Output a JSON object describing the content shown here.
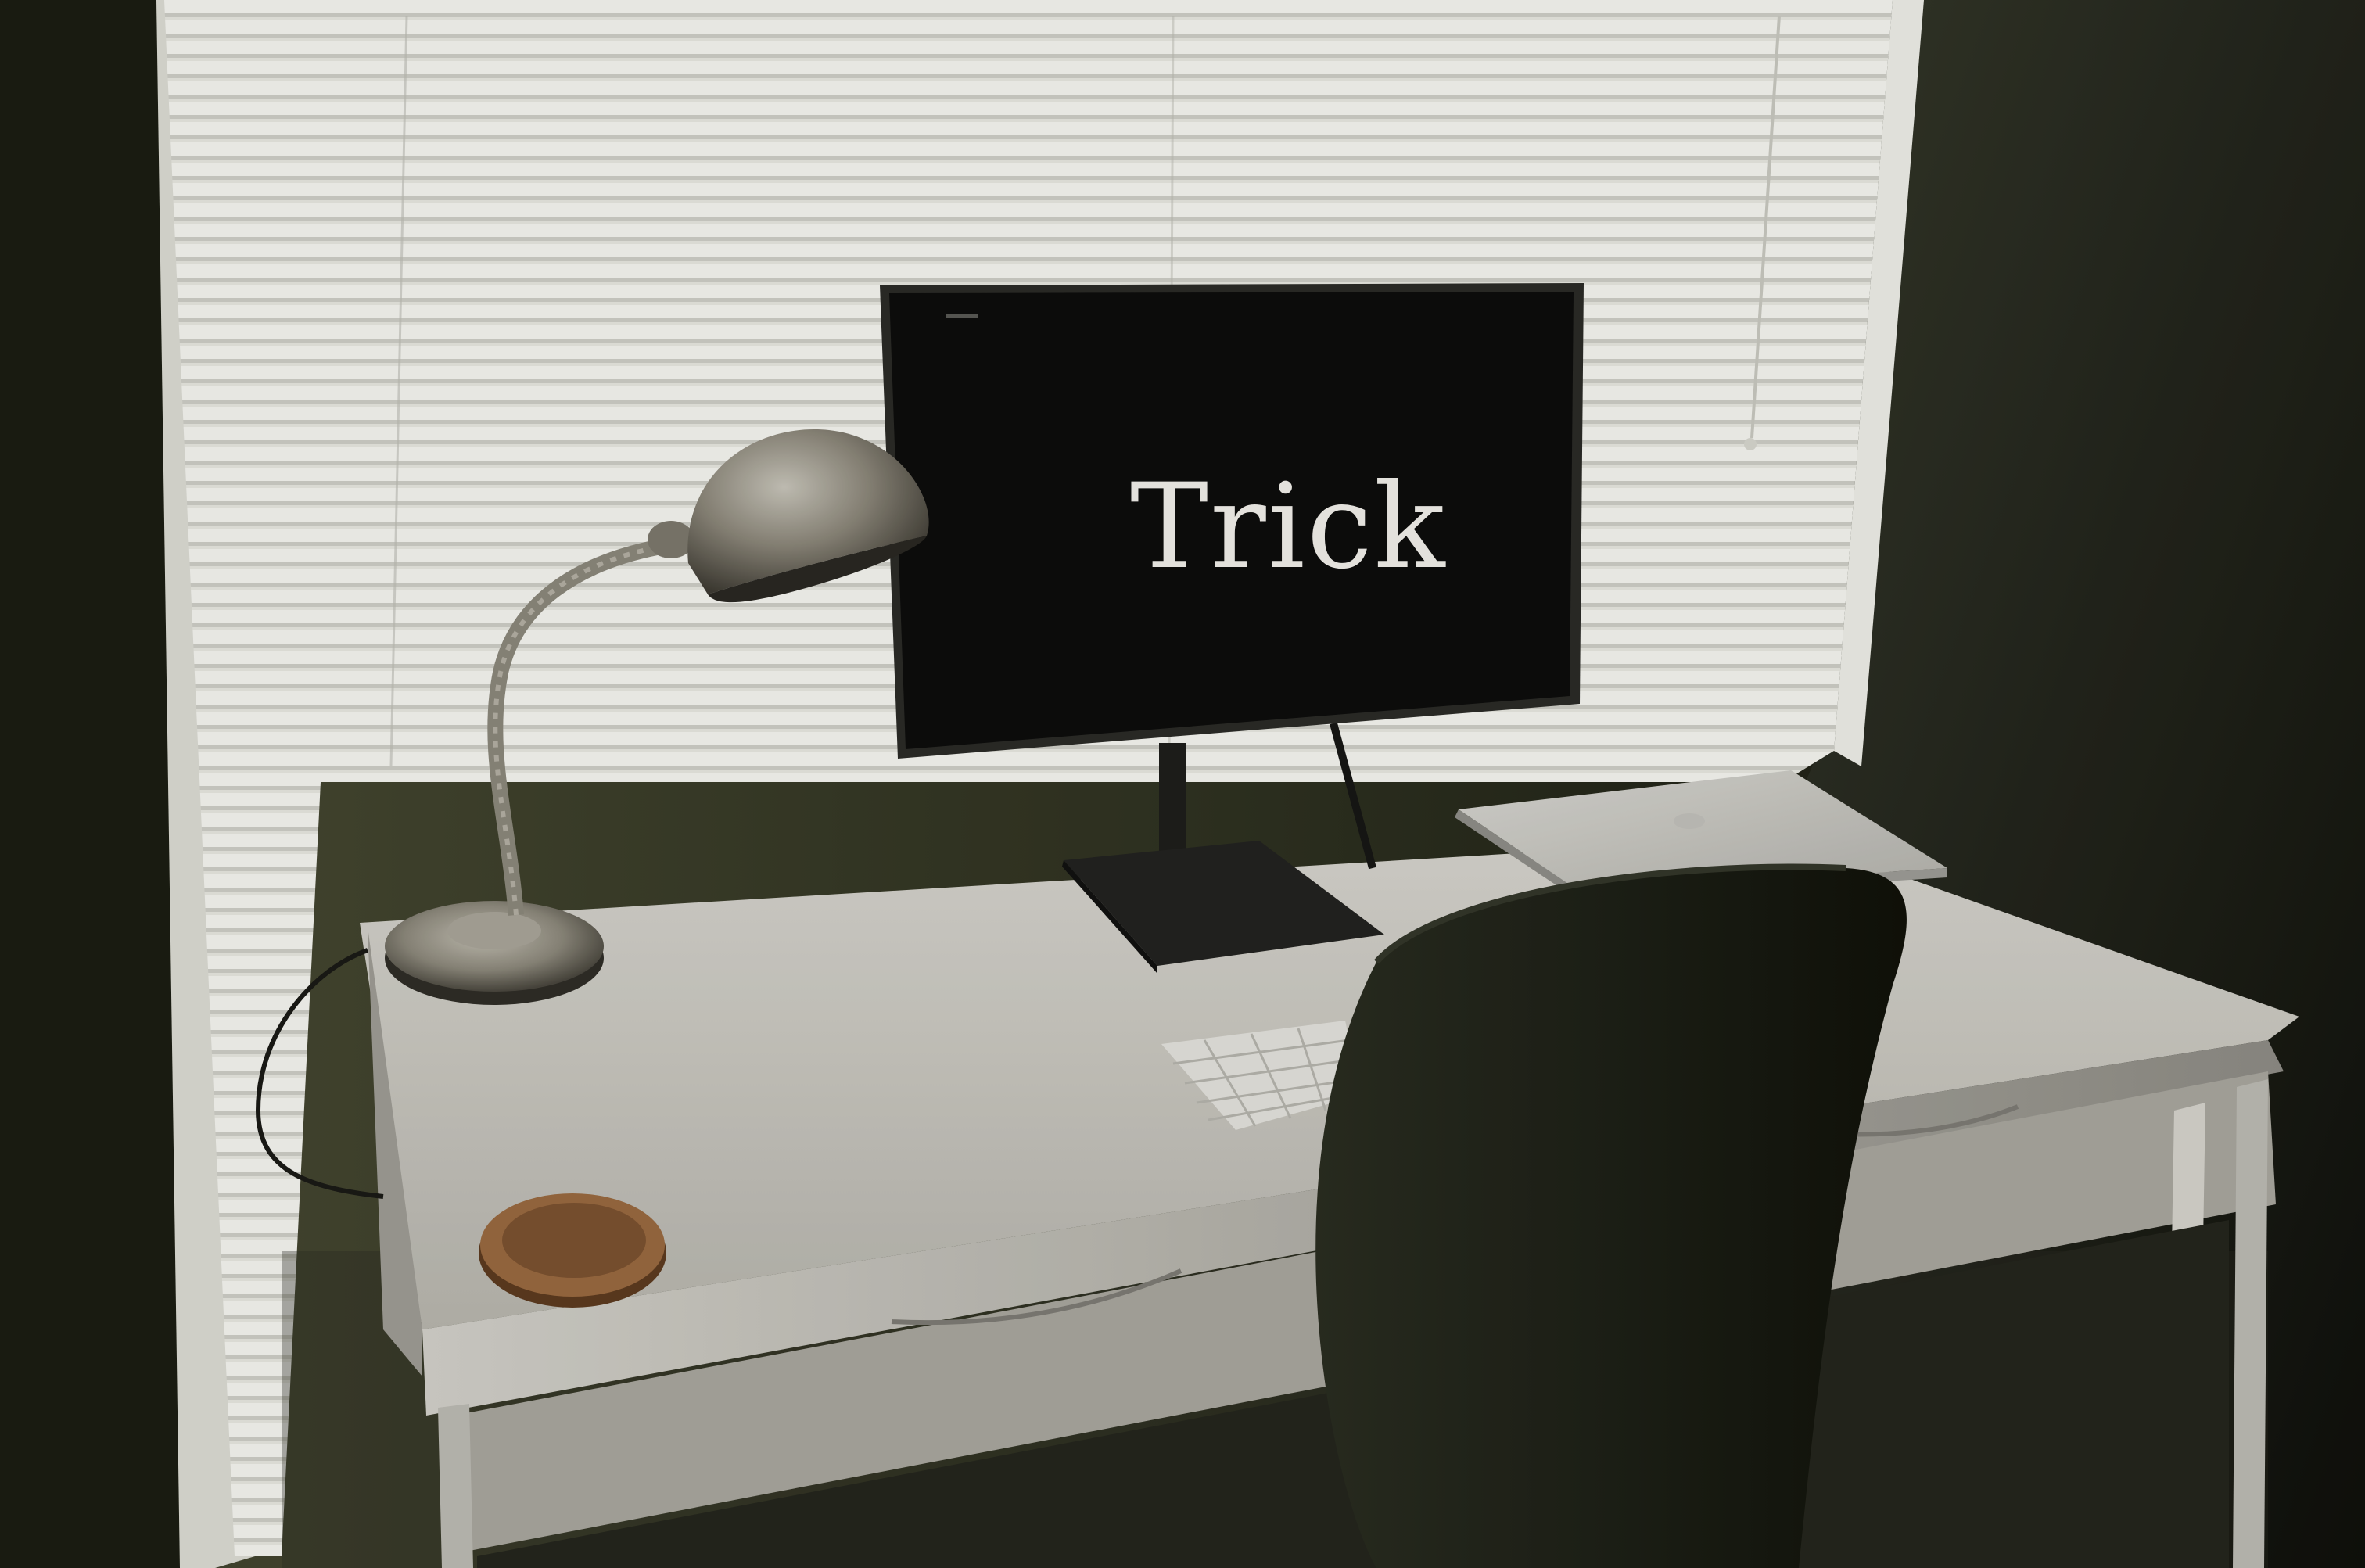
{
  "monitor": {
    "screen_text": "Trick"
  },
  "colors": {
    "wall": "#2e3120",
    "wall_dark": "#15160f",
    "blinds_light": "#f4f4ee",
    "blinds_shadow": "#c9c9c2",
    "desk_top": "#c9c7c0",
    "desk_front": "#b3b1aa",
    "monitor_screen": "#0d0d0c",
    "chair": "#1b1e15",
    "lamp_metal": "#8e8a7e",
    "coaster": "#8a5a34"
  },
  "objects": {
    "window": "window-with-blinds",
    "monitor": "external-display",
    "lamp": "desk-lamp",
    "laptop": "closed-laptop",
    "keyboard": "wireless-keyboard",
    "coaster": "cork-coaster",
    "chair": "office-chair",
    "desk": "white-desk"
  }
}
